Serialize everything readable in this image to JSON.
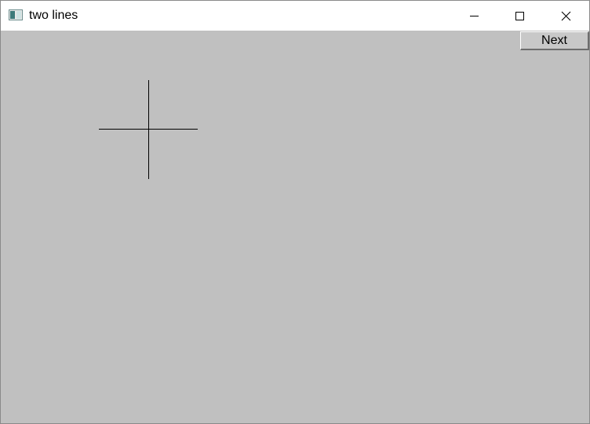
{
  "window": {
    "title": "two lines",
    "icon": "app-window-icon"
  },
  "titlebar_controls": {
    "minimize_icon": "minimize-icon",
    "maximize_icon": "maximize-icon",
    "close_icon": "close-icon"
  },
  "toolbar": {
    "next_label": "Next"
  },
  "canvas": {
    "shapes": [
      "horizontal-line",
      "vertical-line"
    ],
    "line_color": "#000000",
    "background_color": "#c0c0c0"
  }
}
